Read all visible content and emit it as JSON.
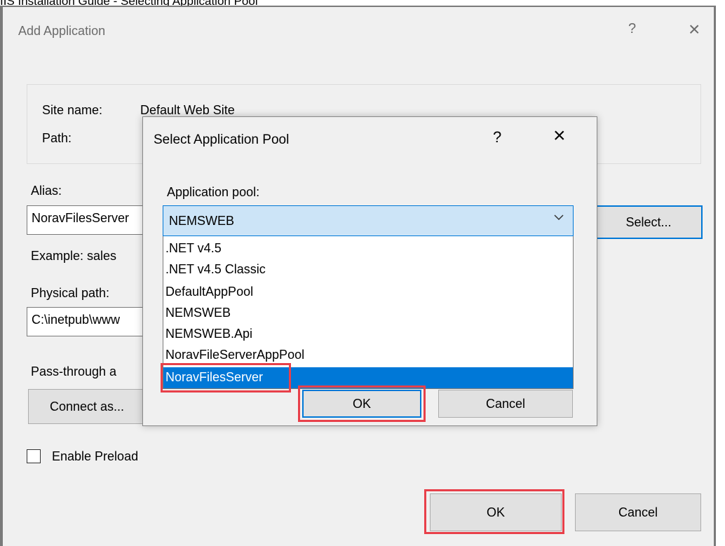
{
  "document_caption": "IIS Installation Guide - Selecting Application Pool",
  "dialog": {
    "title": "Add Application",
    "help_glyph": "?",
    "close_glyph": "×",
    "site_name_label": "Site name:",
    "site_name_value": "Default Web Site",
    "path_label": "Path:",
    "alias_label": "Alias:",
    "alias_value": "NoravFilesServer",
    "example_text": "Example: sales",
    "physical_path_label": "Physical path:",
    "physical_path_value": "C:\\inetpub\\www",
    "pass_through_label": "Pass-through a",
    "connect_as_label": "Connect as...",
    "select_label": "Select...",
    "enable_preload_label": "Enable Preload",
    "enable_preload_checked": false,
    "ok_label": "OK",
    "cancel_label": "Cancel"
  },
  "pool_dialog": {
    "title": "Select Application Pool",
    "help_glyph": "?",
    "close_glyph": "×",
    "pool_label": "Application pool:",
    "selected_value": "NEMSWEB",
    "options": [
      ".NET v4.5",
      ".NET v4.5 Classic",
      "DefaultAppPool",
      "NEMSWEB",
      "NEMSWEB.Api",
      "NoravFileServerAppPool",
      "NoravFilesServer"
    ],
    "highlighted_option": "NoravFilesServer",
    "ok_label": "OK",
    "cancel_label": "Cancel"
  },
  "colors": {
    "highlight_box": "#e8404a",
    "selection": "#0078d7",
    "combo_background": "#cce4f7"
  }
}
